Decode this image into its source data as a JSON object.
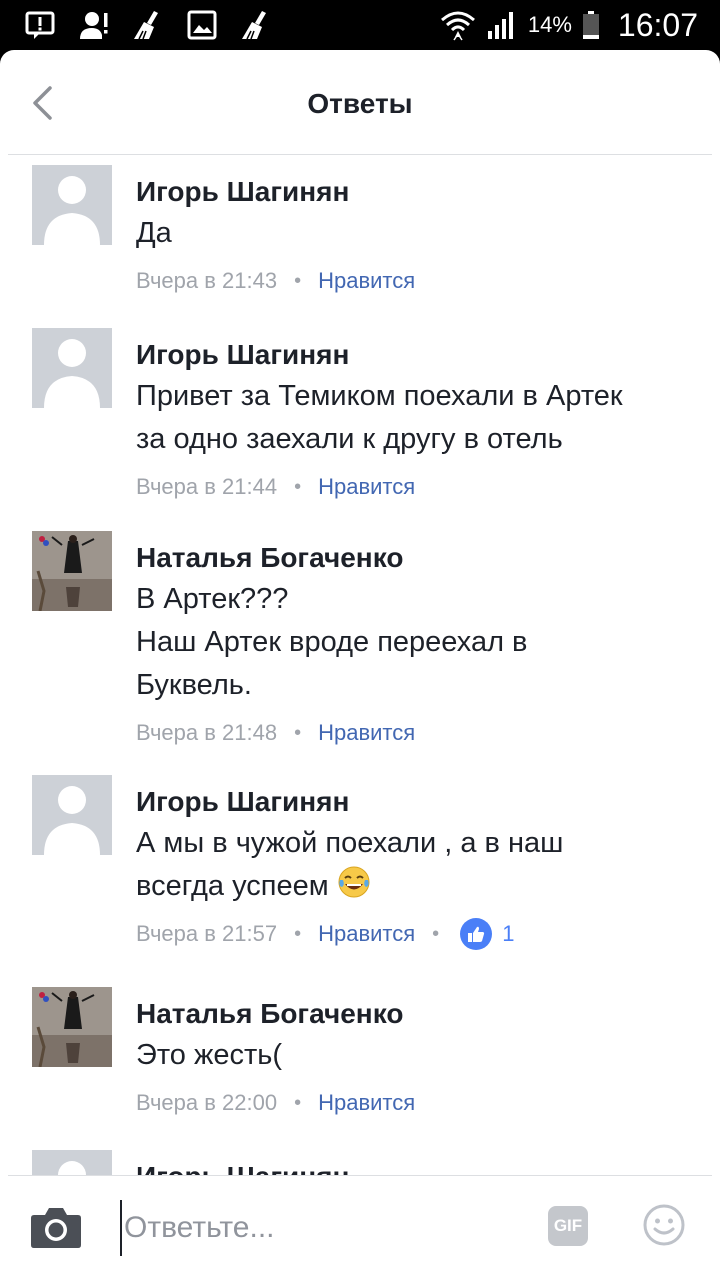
{
  "status_bar": {
    "battery": "14%",
    "time": "16:07",
    "left_icons": [
      "alert-box-icon",
      "alert-person-icon",
      "broom-icon",
      "image-icon",
      "broom-icon"
    ]
  },
  "header": {
    "title": "Ответы",
    "back_icon": "chevron-left-icon"
  },
  "comments": [
    {
      "author": "Игорь Шагинян",
      "text": "Да",
      "time": "Вчера в 21:43",
      "like_label": "Нравится",
      "avatar": "default"
    },
    {
      "author": "Игорь Шагинян",
      "text": "Привет за Темиком поехали в Артек\nза одно заехали к другу в отель",
      "time": "Вчера в 21:44",
      "like_label": "Нравится",
      "avatar": "default"
    },
    {
      "author": "Наталья Богаченко",
      "text": "В Артек???\nНаш Артек вроде переехал в\nБуквель.",
      "time": "Вчера в 21:48",
      "like_label": "Нравится",
      "avatar": "photo"
    },
    {
      "author": "Игорь Шагинян",
      "text": "А мы в чужой поехали , а в наш\nвсегда успеем",
      "emoji": "tears-of-joy-emoji",
      "time": "Вчера в 21:57",
      "like_label": "Нравится",
      "like_count": "1",
      "avatar": "default"
    },
    {
      "author": "Наталья Богаченко",
      "text": "Это жесть(",
      "time": "Вчера в 22:00",
      "like_label": "Нравится",
      "avatar": "photo"
    },
    {
      "author": "Игорь Шагинян",
      "avatar": "default"
    }
  ],
  "composer": {
    "placeholder": "Ответьте...",
    "gif_label": "GIF",
    "camera_icon": "camera-icon",
    "emoji_icon": "smiley-icon"
  },
  "colors": {
    "link": "#4267b2",
    "like_badge": "#4a7ff7",
    "meta": "#a0a4ab",
    "text": "#1d2129"
  }
}
